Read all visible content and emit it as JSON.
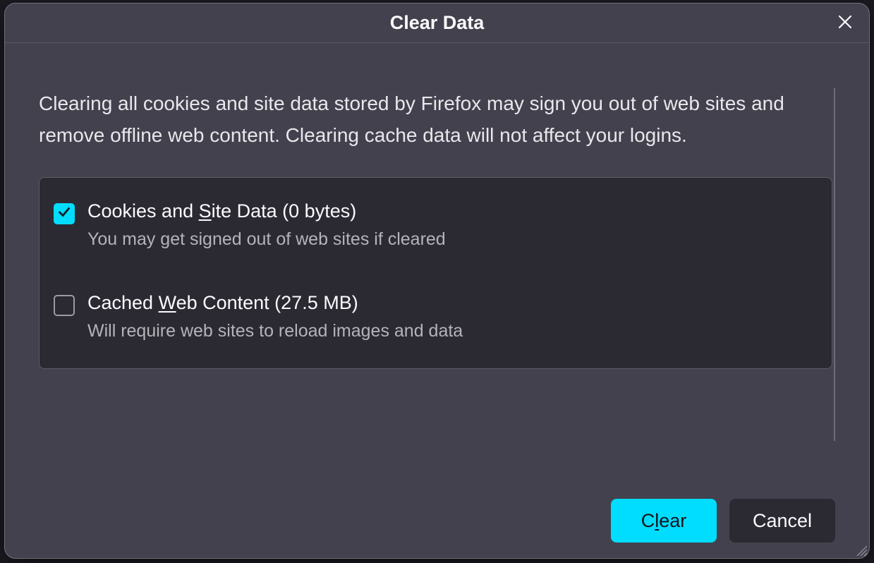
{
  "dialog": {
    "title": "Clear Data",
    "intro": "Clearing all cookies and site data stored by Firefox may sign you out of web sites and remove offline web content. Clearing cache data will not affect your logins."
  },
  "options": {
    "cookies": {
      "checked": true,
      "label_pre": "Cookies and ",
      "label_ul": "S",
      "label_post": "ite Data (0 bytes)",
      "description": "You may get signed out of web sites if cleared"
    },
    "cache": {
      "checked": false,
      "label_pre": "Cached ",
      "label_ul": "W",
      "label_post": "eb Content (27.5 MB)",
      "description": "Will require web sites to reload images and data"
    }
  },
  "buttons": {
    "clear_pre": "C",
    "clear_ul": "l",
    "clear_post": "ear",
    "cancel": "Cancel"
  }
}
